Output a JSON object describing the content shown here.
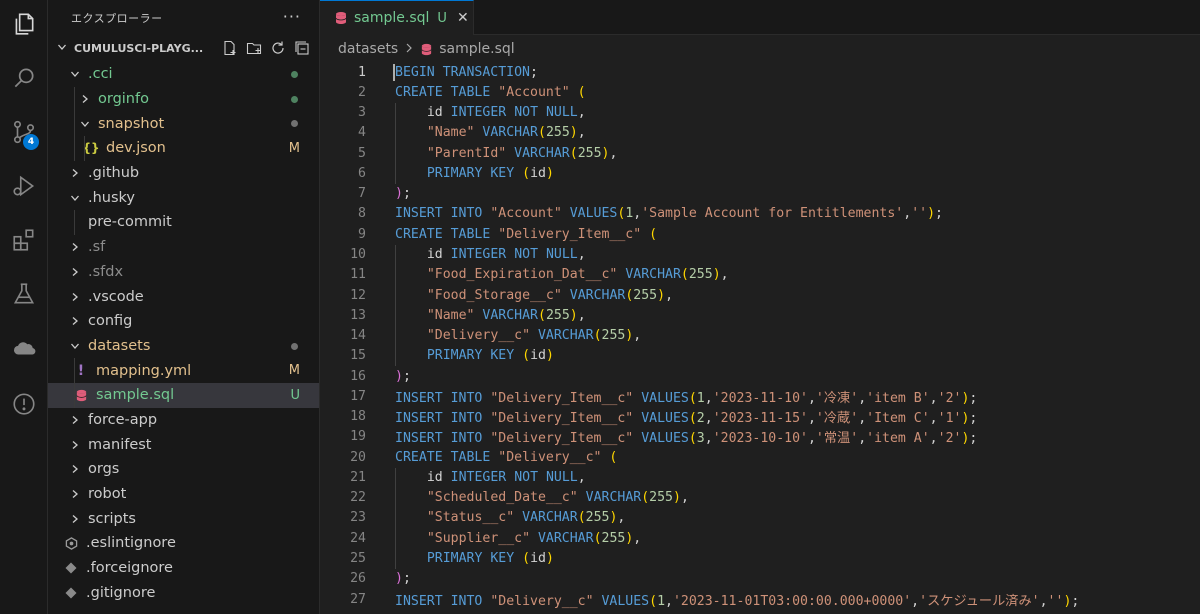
{
  "explorer": {
    "title": "エクスプローラー",
    "more": "···",
    "workspace": "CUMULUSCI-PLAYG...",
    "items": [
      {
        "label": ".cci",
        "kind": "folder",
        "open": true,
        "level": 1,
        "color": "#73c991",
        "deco": "dot"
      },
      {
        "label": "orginfo",
        "kind": "folder",
        "open": false,
        "level": 2,
        "color": "#73c991",
        "deco": "dot"
      },
      {
        "label": "snapshot",
        "kind": "folder",
        "open": true,
        "level": 2,
        "color": "#e2c08d",
        "deco": "dot-gray"
      },
      {
        "label": "dev.json",
        "kind": "json",
        "level": 3,
        "color": "#e2c08d",
        "deco": "M"
      },
      {
        "label": ".github",
        "kind": "folder",
        "open": false,
        "level": 1,
        "color": "#cccccc"
      },
      {
        "label": ".husky",
        "kind": "folder",
        "open": true,
        "level": 1,
        "color": "#cccccc"
      },
      {
        "label": "pre-commit",
        "kind": "file",
        "level": 2,
        "color": "#cccccc"
      },
      {
        "label": ".sf",
        "kind": "folder",
        "open": false,
        "level": 1,
        "color": "#8c8c8c"
      },
      {
        "label": ".sfdx",
        "kind": "folder",
        "open": false,
        "level": 1,
        "color": "#8c8c8c"
      },
      {
        "label": ".vscode",
        "kind": "folder",
        "open": false,
        "level": 1,
        "color": "#cccccc"
      },
      {
        "label": "config",
        "kind": "folder",
        "open": false,
        "level": 1,
        "color": "#cccccc"
      },
      {
        "label": "datasets",
        "kind": "folder",
        "open": true,
        "level": 1,
        "color": "#e2c08d",
        "deco": "dot-gray"
      },
      {
        "label": "mapping.yml",
        "kind": "yaml",
        "level": 2,
        "color": "#e2c08d",
        "deco": "M"
      },
      {
        "label": "sample.sql",
        "kind": "sql",
        "level": 2,
        "color": "#73c991",
        "deco": "U",
        "selected": true
      },
      {
        "label": "force-app",
        "kind": "folder",
        "open": false,
        "level": 1,
        "color": "#cccccc"
      },
      {
        "label": "manifest",
        "kind": "folder",
        "open": false,
        "level": 1,
        "color": "#cccccc"
      },
      {
        "label": "orgs",
        "kind": "folder",
        "open": false,
        "level": 1,
        "color": "#cccccc"
      },
      {
        "label": "robot",
        "kind": "folder",
        "open": false,
        "level": 1,
        "color": "#cccccc"
      },
      {
        "label": "scripts",
        "kind": "folder",
        "open": false,
        "level": 1,
        "color": "#cccccc"
      },
      {
        "label": ".eslintignore",
        "kind": "eslint",
        "level": 1,
        "color": "#cccccc"
      },
      {
        "label": ".forceignore",
        "kind": "diamond",
        "level": 1,
        "color": "#cccccc"
      },
      {
        "label": ".gitignore",
        "kind": "diamond",
        "level": 1,
        "color": "#cccccc"
      }
    ]
  },
  "activity": {
    "scm_badge": "4"
  },
  "tab": {
    "name": "sample.sql",
    "status": "U",
    "close": "✕"
  },
  "breadcrumb": {
    "folder": "datasets",
    "file": "sample.sql"
  },
  "colors": {
    "accent": "#0078d4",
    "untracked": "#73c991",
    "modified": "#e2c08d",
    "sql_icon": "#e05d7a",
    "yaml_icon": "#a074c4"
  },
  "code": [
    "BEGIN TRANSACTION;",
    "CREATE TABLE \"Account\" (",
    "    id INTEGER NOT NULL,",
    "    \"Name\" VARCHAR(255),",
    "    \"ParentId\" VARCHAR(255),",
    "    PRIMARY KEY (id)",
    ");",
    "INSERT INTO \"Account\" VALUES(1,'Sample Account for Entitlements','');",
    "CREATE TABLE \"Delivery_Item__c\" (",
    "    id INTEGER NOT NULL,",
    "    \"Food_Expiration_Dat__c\" VARCHAR(255),",
    "    \"Food_Storage__c\" VARCHAR(255),",
    "    \"Name\" VARCHAR(255),",
    "    \"Delivery__c\" VARCHAR(255),",
    "    PRIMARY KEY (id)",
    ");",
    "INSERT INTO \"Delivery_Item__c\" VALUES(1,'2023-11-10','冷凍','item B','2');",
    "INSERT INTO \"Delivery_Item__c\" VALUES(2,'2023-11-15','冷蔵','Item C','1');",
    "INSERT INTO \"Delivery_Item__c\" VALUES(3,'2023-10-10','常温','item A','2');",
    "CREATE TABLE \"Delivery__c\" (",
    "    id INTEGER NOT NULL,",
    "    \"Scheduled_Date__c\" VARCHAR(255),",
    "    \"Status__c\" VARCHAR(255),",
    "    \"Supplier__c\" VARCHAR(255),",
    "    PRIMARY KEY (id)",
    ");",
    "INSERT INTO \"Delivery__c\" VALUES(1,'2023-11-01T03:00:00.000+0000','スケジュール済み','');"
  ]
}
